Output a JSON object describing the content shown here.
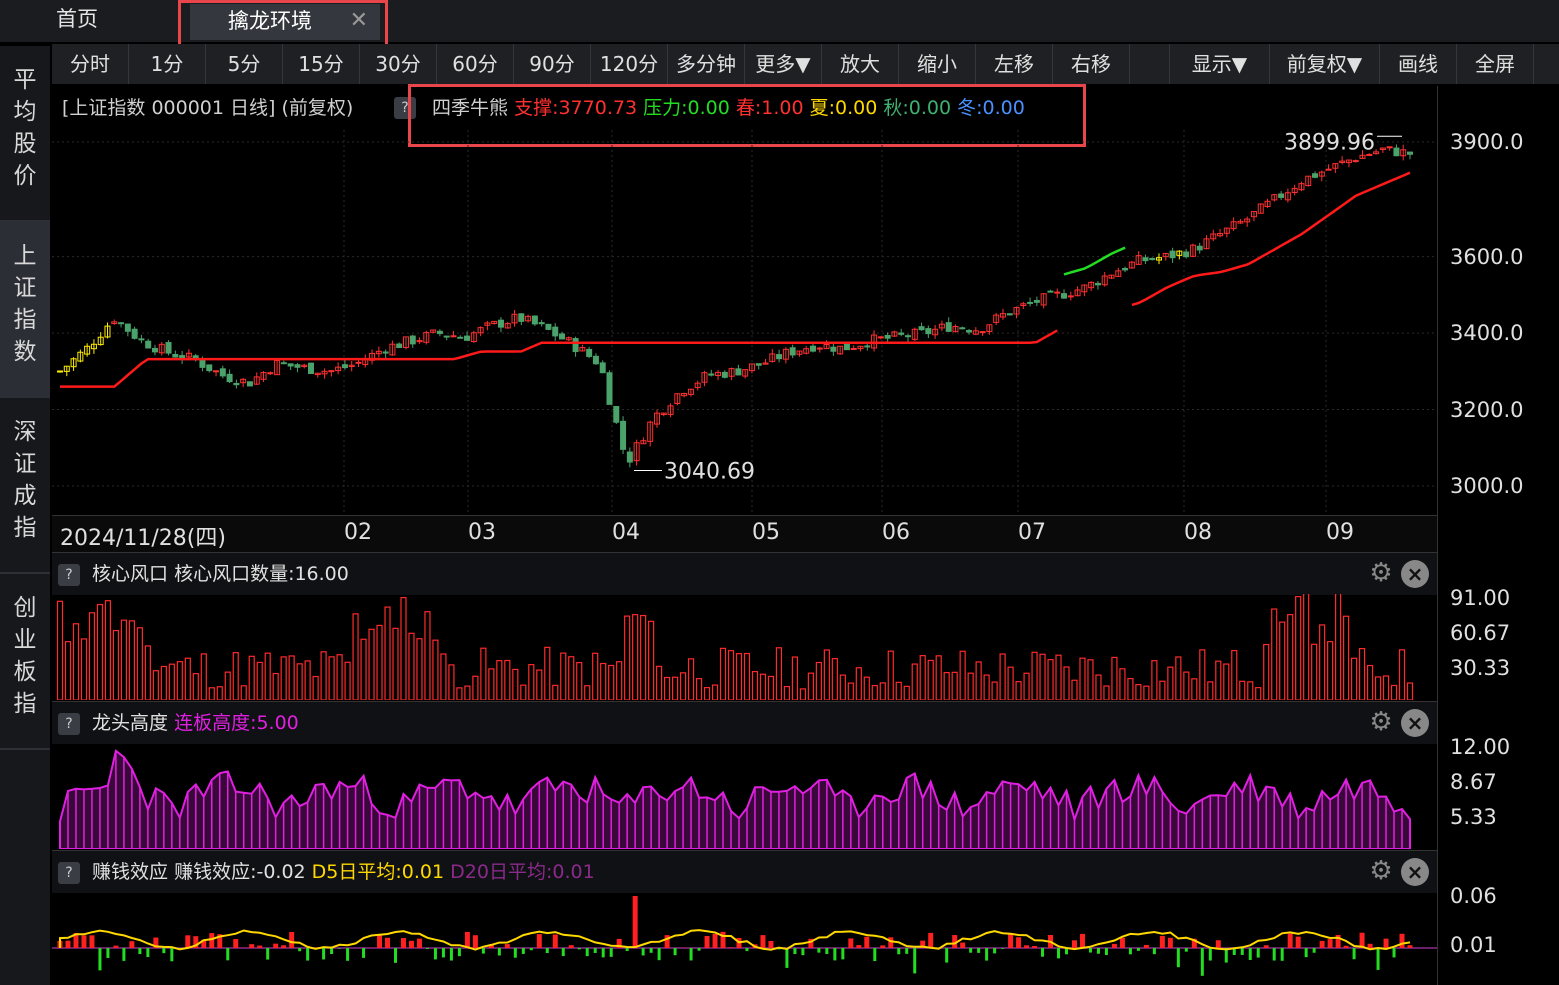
{
  "tabs": {
    "home": "首页",
    "active": "擒龙环境",
    "close": "✕"
  },
  "sidebar": [
    {
      "label": "平均股价",
      "active": false
    },
    {
      "label": "上证指数",
      "active": true
    },
    {
      "label": "深证成指",
      "active": false
    },
    {
      "label": "创业板指",
      "active": false
    }
  ],
  "toolbar": [
    "分时",
    "1分",
    "5分",
    "15分",
    "30分",
    "60分",
    "90分",
    "120分",
    "多分钟",
    "更多▼",
    "放大",
    "缩小",
    "左移",
    "右移",
    "",
    "显示▼",
    "前复权▼",
    "画线",
    "全屏"
  ],
  "info": {
    "title": "[上证指数 000001 日线]  (前复权)",
    "q": "?",
    "indicator_name": "四季牛熊",
    "support": "支撑:3770.73",
    "pressure": "压力:0.00",
    "spring": "春:1.00",
    "summer": "夏:0.00",
    "autumn": "秋:0.00",
    "winter": "冬:0.00"
  },
  "colors": {
    "up": "#ff3030",
    "down": "#4aa36a",
    "support": "#ff1a1a",
    "pressure": "#22dd22",
    "spring_candle": "#ffee00",
    "magenta": "#e020e0",
    "yellow": "#ffd800",
    "purple": "#8a2a8a"
  },
  "main_chart": {
    "yticks": [
      "3900.0",
      "3600.0",
      "3400.0",
      "3200.0",
      "3000.0"
    ],
    "ytick_values": [
      3900,
      3600,
      3400,
      3200,
      3000
    ],
    "high_label": "3899.96",
    "low_label": "3040.69",
    "dates": [
      "2024/11/28(四)",
      "02",
      "03",
      "04",
      "05",
      "06",
      "07",
      "08",
      "09"
    ]
  },
  "chart_data": [
    {
      "type": "candlestick",
      "title": "上证指数 000001 日线",
      "ylim": [
        3000,
        3900
      ],
      "high": 3899.96,
      "low": 3040.69,
      "x": [
        "2024/11/28",
        "02",
        "03",
        "04",
        "05",
        "06",
        "07",
        "08",
        "09"
      ],
      "close_trend": [
        3300,
        3360,
        3440,
        3380,
        3350,
        3330,
        3290,
        3270,
        3320,
        3310,
        3300,
        3320,
        3360,
        3380,
        3400,
        3390,
        3420,
        3440,
        3410,
        3370,
        3320,
        3060,
        3180,
        3250,
        3290,
        3300,
        3320,
        3350,
        3370,
        3360,
        3380,
        3390,
        3400,
        3420,
        3410,
        3450,
        3480,
        3500,
        3520,
        3560,
        3590,
        3600,
        3620,
        3660,
        3700,
        3750,
        3800,
        3830,
        3860,
        3880,
        3870
      ],
      "support_line": "step line below price in uptrend, ends at 3770.73",
      "pressure_line": "step line above price in downtrend"
    },
    {
      "type": "bar",
      "title": "核心风口",
      "series": [
        {
          "name": "核心风口数量",
          "last": 16.0
        }
      ],
      "yticks": [
        91.0,
        60.67,
        30.33
      ]
    },
    {
      "type": "area",
      "title": "龙头高度",
      "series": [
        {
          "name": "连板高度",
          "last": 5.0
        }
      ],
      "yticks": [
        12.0,
        8.67,
        5.33
      ]
    },
    {
      "type": "bar",
      "title": "赚钱效应",
      "series": [
        {
          "name": "赚钱效应",
          "last": -0.02
        },
        {
          "name": "D5日平均",
          "last": 0.01
        },
        {
          "name": "D20日平均",
          "last": 0.01
        }
      ],
      "yticks": [
        0.06,
        0.01
      ]
    }
  ],
  "sub1": {
    "q": "?",
    "name": "核心风口",
    "value": "核心风口数量:16.00",
    "yticks": [
      "91.00",
      "60.67",
      "30.33"
    ]
  },
  "sub2": {
    "q": "?",
    "name": "龙头高度",
    "value": "连板高度:5.00",
    "yticks": [
      "12.00",
      "8.67",
      "5.33"
    ]
  },
  "sub3": {
    "q": "?",
    "name": "赚钱效应",
    "value": "赚钱效应:-0.02",
    "d5": "D5日平均:0.01",
    "d20": "D20日平均:0.01",
    "yticks": [
      "0.06",
      "0.01"
    ]
  },
  "icons": {
    "gear": "gear-icon",
    "close": "close-circle-icon"
  }
}
